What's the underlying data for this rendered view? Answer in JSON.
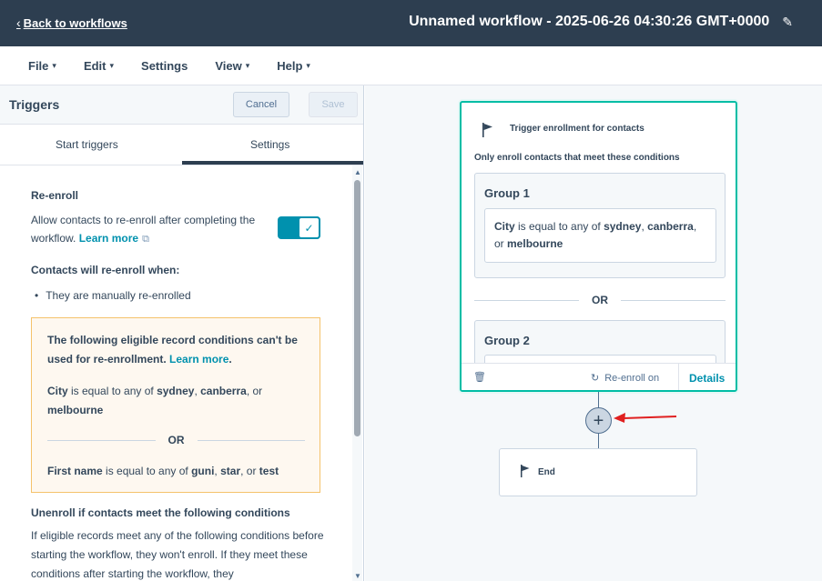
{
  "header": {
    "back_label": "Back to workflows",
    "workflow_title": "Unnamed workflow - 2025-06-26 04:30:26 GMT+0000"
  },
  "menu": {
    "file": "File",
    "edit": "Edit",
    "settings": "Settings",
    "view": "View",
    "help": "Help"
  },
  "panel": {
    "title": "Triggers",
    "cancel_label": "Cancel",
    "save_label": "Save",
    "tabs": {
      "start": "Start triggers",
      "settings": "Settings"
    },
    "reenroll": {
      "heading": "Re-enroll",
      "text": "Allow contacts to re-enroll after completing the workflow.",
      "learn_more": "Learn more",
      "toggle_on": true
    },
    "contacts_heading": "Contacts will re-enroll when:",
    "bullet": "They are manually re-enrolled",
    "warning": {
      "text": "The following eligible record conditions can't be used for re-enrollment.",
      "learn_more": "Learn more",
      "period": ".",
      "cond1": {
        "field": "City",
        "op": " is equal to any of ",
        "v1": "sydney",
        "sep1": ", ",
        "v2": "canberra",
        "sep2": ", or ",
        "v3": "melbourne"
      },
      "or": "OR",
      "cond2": {
        "field": "First name",
        "op": " is equal to any of ",
        "v1": "guni",
        "sep1": ", ",
        "v2": "star",
        "sep2": ", or ",
        "v3": "test"
      }
    },
    "unenroll": {
      "heading": "Unenroll if contacts meet the following conditions",
      "text": "If eligible records meet any of the following conditions before starting the workflow, they won't enroll. If they meet these conditions after starting the workflow, they"
    }
  },
  "canvas": {
    "trigger": {
      "title": "Trigger enrollment for contacts",
      "subtitle": "Only enroll contacts that meet these conditions",
      "group1": {
        "title": "Group 1",
        "field": "City",
        "op": " is equal to any of ",
        "v1": "sydney",
        "sep1": ", ",
        "v2": "canberra",
        "sep2": ", or ",
        "v3": "melbourne"
      },
      "or": "OR",
      "group2": {
        "title": "Group 2"
      },
      "reenroll_status": "Re-enroll on",
      "details": "Details"
    },
    "end_label": "End"
  },
  "colors": {
    "header_bg": "#2d3e50",
    "accent": "#0091ae",
    "trigger_border": "#00bda5",
    "warning_border": "#f5c26b",
    "warning_bg": "#fef8f0",
    "arrow": "#e02020"
  }
}
